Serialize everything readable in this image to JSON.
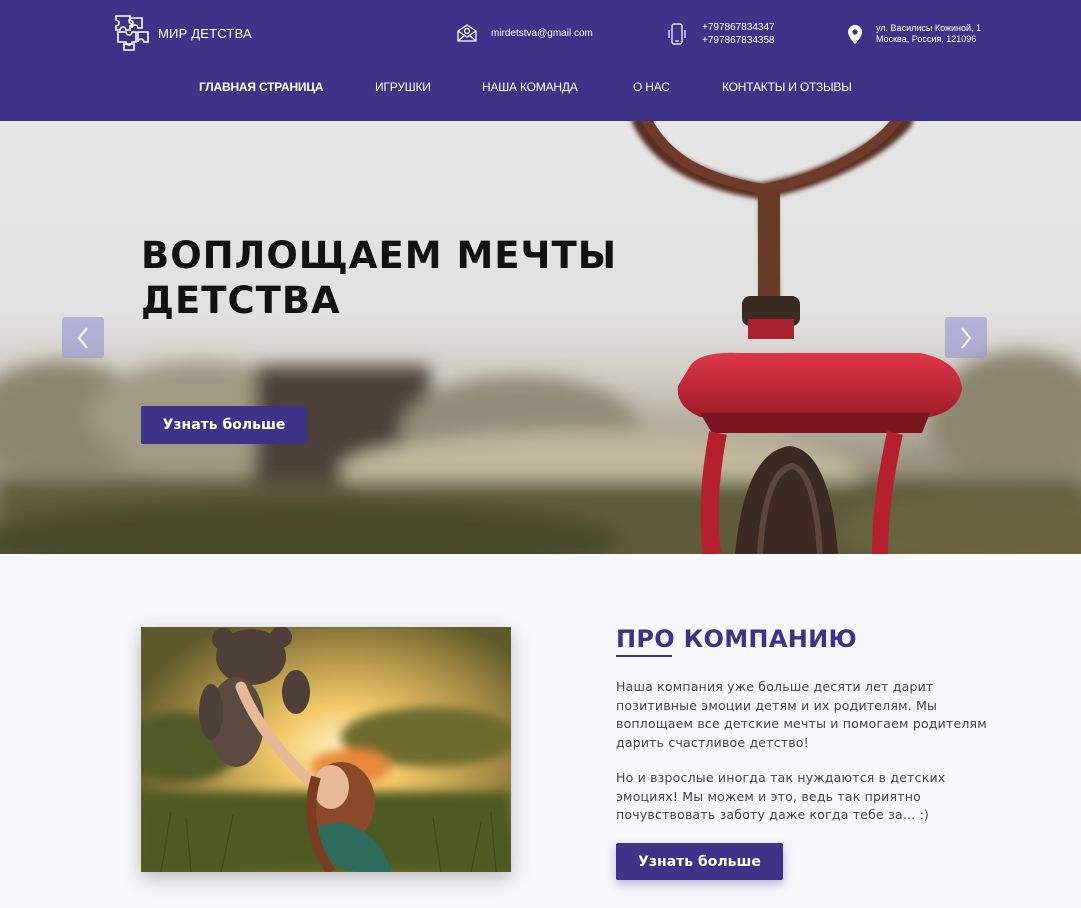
{
  "header": {
    "logo_text": "МИР ДЕТСТВА",
    "email": "mirdetstva@gmail.com",
    "phone_1": "+797867834347",
    "phone_2": "+797867834358",
    "address_line1": "ул. Василисы Кожиной, 1",
    "address_line2": "Москва, Россия, 121096"
  },
  "nav": {
    "items": [
      {
        "label": "ГЛАВНАЯ СТРАНИЦА",
        "active": true
      },
      {
        "label": "ИГРУШКИ",
        "active": false
      },
      {
        "label": "НАША КОМАНДА",
        "active": false
      },
      {
        "label": "О НАС",
        "active": false
      },
      {
        "label": "КОНТАКТЫ И ОТЗЫВЫ",
        "active": false
      }
    ]
  },
  "hero": {
    "title_line1": "ВОПЛОЩАЕМ МЕЧТЫ",
    "title_line2": "ДЕТСТВА",
    "button_label": "Узнать больше"
  },
  "about": {
    "title": "ПРО КОМПАНИЮ",
    "paragraph_1": "Наша компания уже больше десяти лет дарит позитивные эмоции детям и их родителям. Мы воплощаем все детские мечты и помогаем родителям дарить счастливое детство!",
    "paragraph_2": "Но и взрослые иногда так нуждаются в детских эмоциях! Мы можем и это, ведь так приятно почувствовать заботу даже когда тебе за... :)",
    "button_label": "Узнать больше"
  },
  "colors": {
    "brand": "#3d3388",
    "hero_arrow": "#9c9bd2",
    "background": "#f7f8fc"
  },
  "icons": [
    "puzzle-logo-icon",
    "mail-icon",
    "phone-icon",
    "location-pin-icon",
    "chevron-left-icon",
    "chevron-right-icon"
  ]
}
